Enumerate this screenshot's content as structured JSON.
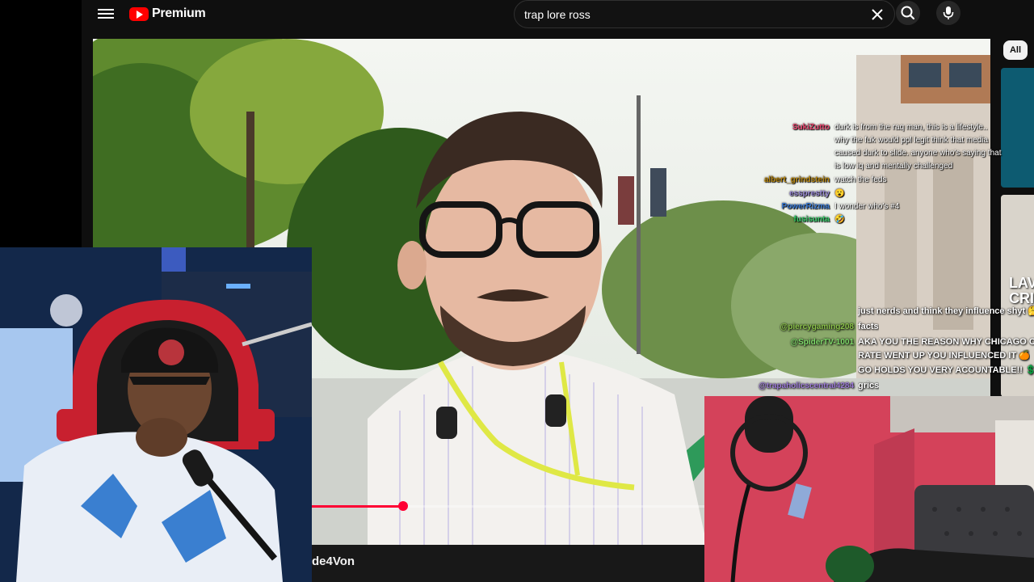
{
  "header": {
    "brand": "Premium",
    "search": {
      "value": "trap lore ross",
      "placeholder": "Search"
    },
    "icons": [
      "menu-icon",
      "youtube-logo-icon",
      "close-icon",
      "search-icon",
      "microphone-icon"
    ]
  },
  "chips": {
    "all": "All"
  },
  "player": {
    "progress_fraction": 0.232,
    "channel_name": "de4Von"
  },
  "chat": [
    {
      "user": "SukiZutto",
      "color": "#e8436c",
      "lines": [
        "durk is from the raq man, this is a lifestyle..",
        "why the fuk would ppl legit think that media",
        "caused durk to slide. anyone who's saying that",
        "is low iq and mentally challenged"
      ]
    },
    {
      "user": "albert_grindstein",
      "color": "#b8860b",
      "lines": [
        "watch the feds"
      ]
    },
    {
      "user": "essprestty",
      "color": "#9a8ad6",
      "lines": [
        "😮"
      ]
    },
    {
      "user": "PowerRizma",
      "color": "#3a7bd5",
      "lines": [
        "I wonder who's #4"
      ]
    },
    {
      "user": "fusisunta",
      "color": "#33cc66",
      "lines": [
        "🤣"
      ]
    }
  ],
  "chat_secondary": [
    {
      "user": "",
      "text": "just nerds and think they influence shyt 🤔"
    },
    {
      "user": "@piercygaming208",
      "color": "#8bc34a",
      "text": "facts"
    },
    {
      "user": "@SpiderTV-1001",
      "color": "#7fdb6a",
      "text": "AKA YOU THE REASON WHY CHICAGO CRI"
    },
    {
      "user": "",
      "text": "RATE WENT UP YOU INFLUENCED IT 🍊"
    },
    {
      "user": "",
      "text": "GO HOLDS YOU VERY ACOUNTABLE!! 💲"
    },
    {
      "user": "@trapaholicscentral4284",
      "color": "#9c7ad6",
      "text": "grics"
    }
  ],
  "side": {
    "thumb2_text": "LAV\nCRI"
  },
  "colors": {
    "accent": "#ff0033",
    "background": "#0f0f0f"
  }
}
